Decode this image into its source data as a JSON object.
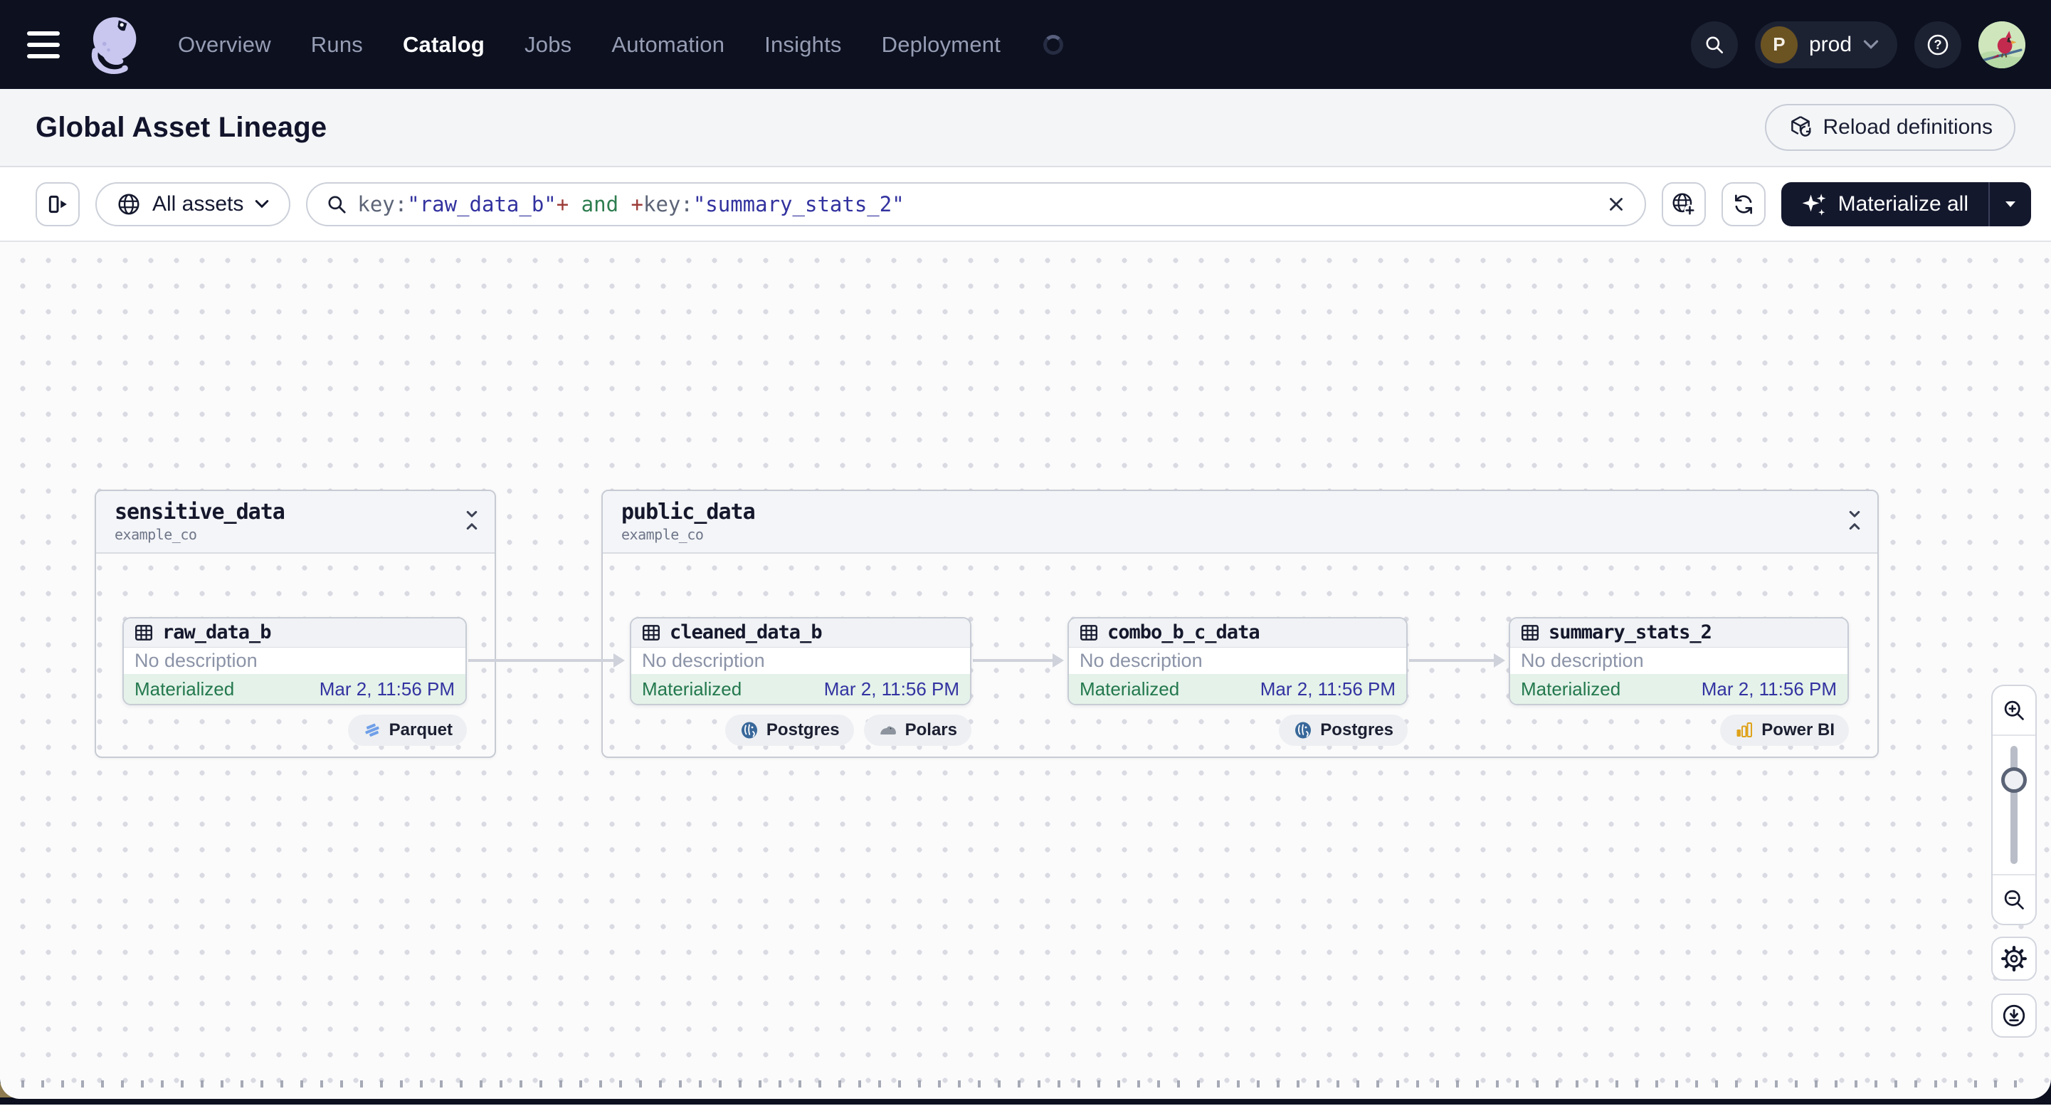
{
  "navbar": {
    "items": [
      "Overview",
      "Runs",
      "Catalog",
      "Jobs",
      "Automation",
      "Insights",
      "Deployment"
    ],
    "active_item": "Catalog",
    "deployment": {
      "initial": "P",
      "label": "prod"
    }
  },
  "header": {
    "title": "Global Asset Lineage",
    "reload_label": "Reload definitions"
  },
  "toolbar": {
    "scope_label": "All assets",
    "materialize_label": "Materialize all",
    "query": {
      "parts": [
        "key:",
        "\"raw_data_b\"",
        "+",
        " and ",
        "+",
        "key:",
        "\"summary_stats_2\""
      ]
    }
  },
  "graph": {
    "groups": [
      {
        "name": "sensitive_data",
        "subtitle": "example_co"
      },
      {
        "name": "public_data",
        "subtitle": "example_co"
      }
    ],
    "assets": [
      {
        "name": "raw_data_b",
        "description": "No description",
        "status": "Materialized",
        "timestamp": "Mar 2, 11:56 PM"
      },
      {
        "name": "cleaned_data_b",
        "description": "No description",
        "status": "Materialized",
        "timestamp": "Mar 2, 11:56 PM"
      },
      {
        "name": "combo_b_c_data",
        "description": "No description",
        "status": "Materialized",
        "timestamp": "Mar 2, 11:56 PM"
      },
      {
        "name": "summary_stats_2",
        "description": "No description",
        "status": "Materialized",
        "timestamp": "Mar 2, 11:56 PM"
      }
    ],
    "tags": {
      "parquet": "Parquet",
      "postgres": "Postgres",
      "polars": "Polars",
      "powerbi": "Power BI"
    }
  },
  "colors": {
    "navbar_bg": "#0c101f",
    "materialize_bg": "#14182d",
    "status_green": "#23784d",
    "status_green_bg": "#e4f2e9",
    "timestamp_indigo": "#3333a1",
    "query_string": "#32329f",
    "query_operator": "#9c3c38",
    "query_and": "#2e7d4f",
    "parquet_blue": "#6f9fe8",
    "postgres_blue": "#39689a",
    "polars_gray": "#8d949e",
    "powerbi_gold": "#dfa21a"
  }
}
